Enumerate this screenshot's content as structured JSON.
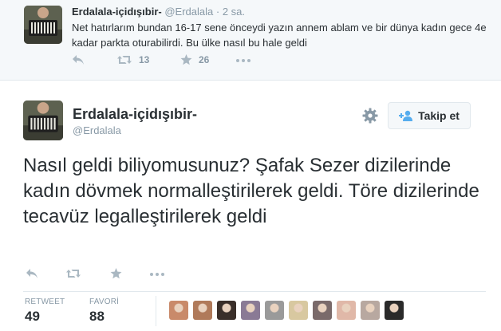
{
  "reply_tweet": {
    "name": "Erdalala-içidışıbir-",
    "handle": "@Erdalala",
    "dot": "·",
    "time": "2 sa.",
    "text": "Net hatırlarım bundan 16-17 sene önceydi yazın annem ablam ve bir dünya kadın gece 4e kadar parkta oturabilirdi. Bu ülke nasıl bu hale geldi",
    "retweet_count": "13",
    "favorite_count": "26"
  },
  "main_tweet": {
    "name": "Erdalala-içidışıbir-",
    "handle": "@Erdalala",
    "follow_label": "Takip et",
    "text": "Nasıl geldi biliyomusunuz? Şafak Sezer dizilerinde kadın dövmek normalleştirilerek geldi. Töre dizilerinde tecavüz legalleştirilerek geldi",
    "stats": {
      "retweet_label": "RETWEET",
      "retweet_value": "49",
      "favorite_label": "FAVORİ",
      "favorite_value": "88"
    }
  },
  "colors": {
    "icon_gray": "#aab8c2",
    "muted_text": "#8899a6",
    "text": "#292f33",
    "link_blue": "#55acee",
    "reply_background": "#f5f8fa",
    "border": "#e1e8ed"
  },
  "favoriter_avatar_colors": [
    "#c98a6a",
    "#b07a5a",
    "#3a2f2a",
    "#8a7a95",
    "#9a9a9a",
    "#d8c8a0",
    "#7a6a6a",
    "#e0b8a8",
    "#b8a8a0",
    "#2a2a2a"
  ]
}
